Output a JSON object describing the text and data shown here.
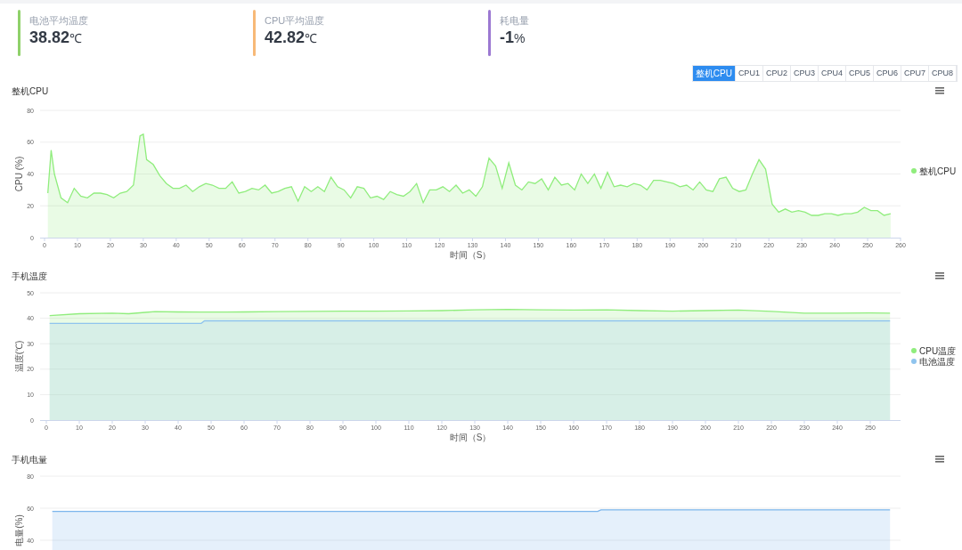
{
  "stats": [
    {
      "label": "电池平均温度",
      "value": "38.82",
      "unit": "℃",
      "color": "#8fd16a"
    },
    {
      "label": "CPU平均温度",
      "value": "42.82",
      "unit": "℃",
      "color": "#f7b977"
    },
    {
      "label": "耗电量",
      "value": "-1",
      "unit": "%",
      "color": "#9c79d2"
    }
  ],
  "cpu_tabs": [
    {
      "label": "整机CPU",
      "selected": true
    },
    {
      "label": "CPU1",
      "selected": false
    },
    {
      "label": "CPU2",
      "selected": false
    },
    {
      "label": "CPU3",
      "selected": false
    },
    {
      "label": "CPU4",
      "selected": false
    },
    {
      "label": "CPU5",
      "selected": false
    },
    {
      "label": "CPU6",
      "selected": false
    },
    {
      "label": "CPU7",
      "selected": false
    },
    {
      "label": "CPU8",
      "selected": false
    }
  ],
  "charts": [
    {
      "title": "整机CPU",
      "chart_data": {
        "type": "area",
        "grid": true,
        "legend": true,
        "xlabel": "时间（S）",
        "ylabel": "CPU (%)",
        "xlim": [
          0,
          260
        ],
        "ylim": [
          0,
          80
        ],
        "xticks": [
          0,
          10,
          20,
          30,
          40,
          50,
          60,
          70,
          80,
          90,
          100,
          110,
          120,
          130,
          140,
          150,
          160,
          170,
          180,
          190,
          200,
          210,
          220,
          230,
          240,
          250,
          260
        ],
        "yticks": [
          0,
          20,
          40,
          60,
          80
        ],
        "x": [
          1,
          2,
          3,
          5,
          7,
          9,
          11,
          13,
          15,
          17,
          19,
          21,
          23,
          25,
          27,
          29,
          30,
          31,
          33,
          35,
          37,
          39,
          41,
          43,
          45,
          47,
          49,
          51,
          53,
          55,
          57,
          59,
          61,
          63,
          65,
          67,
          69,
          71,
          73,
          75,
          77,
          79,
          81,
          83,
          85,
          87,
          89,
          91,
          93,
          95,
          97,
          99,
          101,
          103,
          105,
          107,
          109,
          111,
          113,
          115,
          117,
          119,
          121,
          123,
          125,
          127,
          129,
          131,
          133,
          135,
          137,
          139,
          141,
          143,
          145,
          147,
          149,
          151,
          153,
          155,
          157,
          159,
          161,
          163,
          165,
          167,
          169,
          171,
          173,
          175,
          177,
          179,
          181,
          183,
          185,
          187,
          189,
          191,
          193,
          195,
          197,
          199,
          201,
          203,
          205,
          207,
          209,
          211,
          213,
          215,
          217,
          219,
          221,
          223,
          225,
          227,
          229,
          231,
          233,
          235,
          237,
          239,
          241,
          243,
          245,
          247,
          249,
          251,
          253,
          255,
          257
        ],
        "series": [
          {
            "name": "整机CPU",
            "color": "#90ed7d",
            "values": [
              28,
              55,
              40,
              25,
              22,
              31,
              26,
              25,
              28,
              28,
              27,
              25,
              28,
              29,
              33,
              64,
              65,
              49,
              46,
              39,
              34,
              31,
              31,
              33,
              29,
              32,
              34,
              33,
              31,
              31,
              35,
              28,
              29,
              31,
              30,
              33,
              28,
              29,
              31,
              32,
              23,
              32,
              29,
              32,
              29,
              38,
              32,
              30,
              25,
              32,
              31,
              25,
              26,
              24,
              29,
              27,
              26,
              29,
              34,
              22,
              30,
              30,
              32,
              29,
              33,
              28,
              30,
              26,
              32,
              50,
              45,
              31,
              47,
              33,
              30,
              35,
              34,
              37,
              30,
              38,
              33,
              34,
              30,
              40,
              34,
              40,
              31,
              41,
              32,
              33,
              32,
              34,
              33,
              30,
              36,
              36,
              35,
              34,
              32,
              33,
              30,
              35,
              30,
              29,
              37,
              38,
              31,
              29,
              30,
              40,
              49,
              43,
              21,
              16,
              18,
              16,
              17,
              16,
              14,
              14,
              15,
              15,
              14,
              15,
              15,
              16,
              19,
              17,
              17,
              14,
              15
            ]
          }
        ]
      }
    },
    {
      "title": "手机温度",
      "chart_data": {
        "type": "area",
        "grid": true,
        "legend": true,
        "xlabel": "时间（S）",
        "ylabel": "温度(℃)",
        "xlim": [
          0,
          260
        ],
        "ylim": [
          0,
          50
        ],
        "xticks": [
          0,
          10,
          20,
          30,
          40,
          50,
          60,
          70,
          80,
          90,
          100,
          110,
          120,
          130,
          140,
          150,
          160,
          170,
          180,
          190,
          200,
          210,
          220,
          230,
          240,
          250
        ],
        "yticks": [
          0,
          10,
          20,
          30,
          40,
          50
        ],
        "x": [
          1,
          10,
          20,
          25,
          30,
          33,
          40,
          47,
          48,
          60,
          70,
          80,
          90,
          100,
          110,
          120,
          130,
          140,
          150,
          160,
          170,
          180,
          190,
          200,
          210,
          220,
          230,
          240,
          250,
          256
        ],
        "series": [
          {
            "name": "CPU温度",
            "color": "#90ed7d",
            "values": [
              41,
              41.8,
              42,
              41.8,
              42.3,
              42.6,
              42.5,
              42.4,
              42.4,
              42.5,
              42.6,
              42.7,
              42.8,
              42.8,
              42.9,
              43,
              43.3,
              43.5,
              43.3,
              43.2,
              43.3,
              43,
              42.8,
              43,
              43.2,
              42.7,
              42,
              42,
              42.1,
              42
            ]
          },
          {
            "name": "电池温度",
            "color": "#8fc4ee",
            "values": [
              38,
              38,
              38,
              38,
              38,
              38,
              38,
              38,
              39,
              39,
              39,
              39,
              39,
              39,
              39,
              39,
              39,
              39,
              39,
              39,
              39,
              39,
              39,
              39,
              39,
              39,
              39,
              39,
              39,
              39
            ]
          }
        ]
      }
    },
    {
      "title": "手机电量",
      "chart_data": {
        "type": "area",
        "grid": true,
        "ylabel": "电量(%)",
        "xlim": [
          0,
          260
        ],
        "ylim": [
          0,
          80
        ],
        "yticks": [
          40,
          60,
          80
        ],
        "x": [
          1,
          50,
          100,
          150,
          167,
          168,
          200,
          256
        ],
        "series": [
          {
            "color": "#7cb5ec",
            "values": [
              58,
              58,
              58,
              58,
              58,
              59,
              59,
              59
            ]
          }
        ]
      }
    }
  ]
}
